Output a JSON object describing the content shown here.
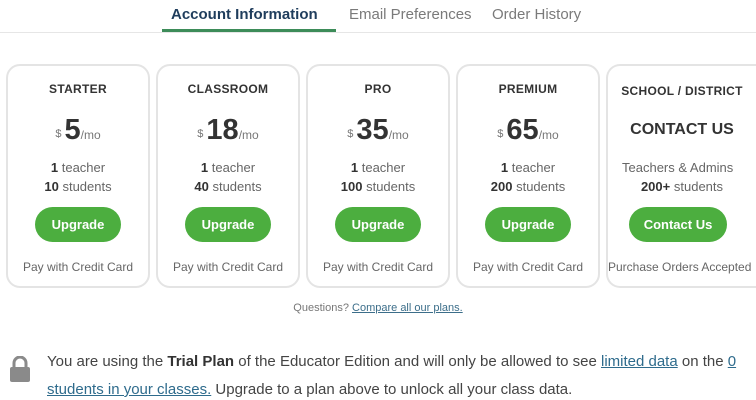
{
  "tabs": [
    {
      "label": "Account Information",
      "active": true
    },
    {
      "label": "Email Preferences",
      "active": false
    },
    {
      "label": "Order History",
      "active": false
    }
  ],
  "plans": [
    {
      "name": "STARTER",
      "currency": "$",
      "price": "5",
      "period": "/mo",
      "teachers_count": "1",
      "teachers_label": "teacher",
      "students_count": "10",
      "students_label": "students",
      "button": "Upgrade",
      "payment": "Pay with Credit Card"
    },
    {
      "name": "CLASSROOM",
      "currency": "$",
      "price": "18",
      "period": "/mo",
      "teachers_count": "1",
      "teachers_label": "teacher",
      "students_count": "40",
      "students_label": "students",
      "button": "Upgrade",
      "payment": "Pay with Credit Card"
    },
    {
      "name": "PRO",
      "currency": "$",
      "price": "35",
      "period": "/mo",
      "teachers_count": "1",
      "teachers_label": "teacher",
      "students_count": "100",
      "students_label": "students",
      "button": "Upgrade",
      "payment": "Pay with Credit Card"
    },
    {
      "name": "PREMIUM",
      "currency": "$",
      "price": "65",
      "period": "/mo",
      "teachers_count": "1",
      "teachers_label": "teacher",
      "students_count": "200",
      "students_label": "students",
      "button": "Upgrade",
      "payment": "Pay with Credit Card"
    }
  ],
  "school": {
    "name": "SCHOOL / DISTRICT",
    "headline": "CONTACT US",
    "line1": "Teachers & Admins",
    "students_count": "200+",
    "students_label": "students",
    "button": "Contact Us",
    "payment": "Purchase Orders Accepted"
  },
  "questions": {
    "prefix": "Questions?",
    "link": "Compare all our plans."
  },
  "notice": {
    "icon": "lock-icon",
    "t1": "You are using the ",
    "plan": "Trial Plan",
    "t2": " of the Educator Edition and will only be allowed to see ",
    "link1": "limited data",
    "t3": " on the ",
    "link2": "0 students in your classes.",
    "t4": " Upgrade to a plan above to unlock all your class data."
  },
  "colors": {
    "accent_green": "#4cae3f",
    "tab_active": "#1f3d5c",
    "tab_underline": "#3d8c59"
  }
}
